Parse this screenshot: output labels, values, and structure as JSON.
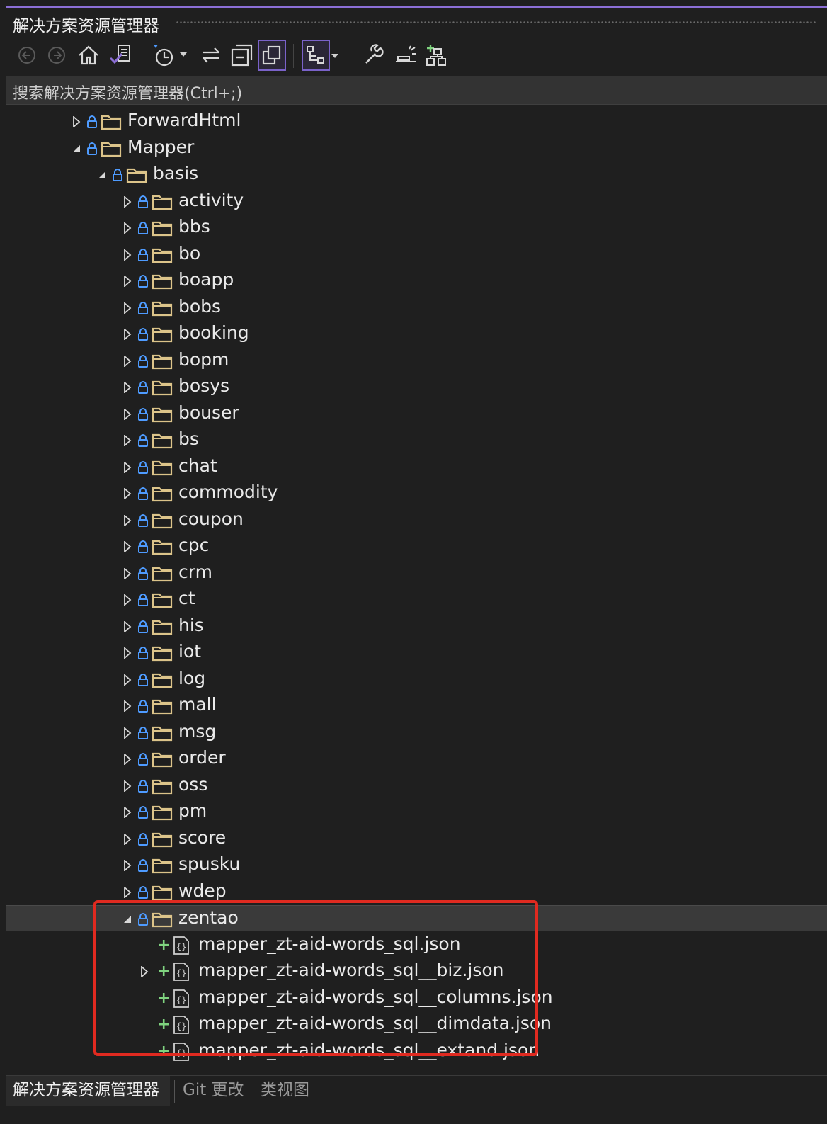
{
  "window": {
    "title": "解决方案资源管理器"
  },
  "search": {
    "placeholder": "搜索解决方案资源管理器(Ctrl+;)"
  },
  "colors": {
    "accent": "#8c6fd6",
    "highlight_box": "#e02a20",
    "folder": "#dcc48a",
    "added": "#7fd37f",
    "lock": "#4e9bff"
  },
  "toolbar": {
    "buttons": [
      {
        "name": "back-button",
        "icon": "arrow-left-circle-icon"
      },
      {
        "name": "forward-button",
        "icon": "arrow-right-circle-icon"
      },
      {
        "name": "home-button",
        "icon": "home-icon"
      },
      {
        "name": "switch-views-button",
        "icon": "visual-studio-views-icon"
      },
      {
        "name": "pending-changes-filter-button",
        "icon": "history-clock-icon"
      },
      {
        "name": "sync-with-document-button",
        "icon": "sync-arrows-icon"
      },
      {
        "name": "collapse-all-button",
        "icon": "collapse-icon"
      },
      {
        "name": "show-all-files-button",
        "icon": "copy-files-icon"
      },
      {
        "name": "view-hierarchy-button",
        "icon": "hierarchy-icon"
      },
      {
        "name": "properties-button",
        "icon": "wrench-icon"
      },
      {
        "name": "preview-selected-button",
        "icon": "preview-icon"
      },
      {
        "name": "new-solution-explorer-button",
        "icon": "new-view-icon"
      }
    ]
  },
  "tree": {
    "nodes": [
      {
        "label": "ForwardHtml",
        "type": "folder",
        "expanded": false,
        "locked": true
      },
      {
        "label": "Mapper",
        "type": "folder",
        "expanded": true,
        "locked": true
      },
      {
        "label": "basis",
        "type": "folder",
        "expanded": true,
        "locked": true
      },
      {
        "label": "activity",
        "type": "folder",
        "expanded": false,
        "locked": true
      },
      {
        "label": "bbs",
        "type": "folder",
        "expanded": false,
        "locked": true
      },
      {
        "label": "bo",
        "type": "folder",
        "expanded": false,
        "locked": true
      },
      {
        "label": "boapp",
        "type": "folder",
        "expanded": false,
        "locked": true
      },
      {
        "label": "bobs",
        "type": "folder",
        "expanded": false,
        "locked": true
      },
      {
        "label": "booking",
        "type": "folder",
        "expanded": false,
        "locked": true
      },
      {
        "label": "bopm",
        "type": "folder",
        "expanded": false,
        "locked": true
      },
      {
        "label": "bosys",
        "type": "folder",
        "expanded": false,
        "locked": true
      },
      {
        "label": "bouser",
        "type": "folder",
        "expanded": false,
        "locked": true
      },
      {
        "label": "bs",
        "type": "folder",
        "expanded": false,
        "locked": true
      },
      {
        "label": "chat",
        "type": "folder",
        "expanded": false,
        "locked": true
      },
      {
        "label": "commodity",
        "type": "folder",
        "expanded": false,
        "locked": true
      },
      {
        "label": "coupon",
        "type": "folder",
        "expanded": false,
        "locked": true
      },
      {
        "label": "cpc",
        "type": "folder",
        "expanded": false,
        "locked": true
      },
      {
        "label": "crm",
        "type": "folder",
        "expanded": false,
        "locked": true
      },
      {
        "label": "ct",
        "type": "folder",
        "expanded": false,
        "locked": true
      },
      {
        "label": "his",
        "type": "folder",
        "expanded": false,
        "locked": true
      },
      {
        "label": "iot",
        "type": "folder",
        "expanded": false,
        "locked": true
      },
      {
        "label": "log",
        "type": "folder",
        "expanded": false,
        "locked": true
      },
      {
        "label": "mall",
        "type": "folder",
        "expanded": false,
        "locked": true
      },
      {
        "label": "msg",
        "type": "folder",
        "expanded": false,
        "locked": true
      },
      {
        "label": "order",
        "type": "folder",
        "expanded": false,
        "locked": true
      },
      {
        "label": "oss",
        "type": "folder",
        "expanded": false,
        "locked": true
      },
      {
        "label": "pm",
        "type": "folder",
        "expanded": false,
        "locked": true
      },
      {
        "label": "score",
        "type": "folder",
        "expanded": false,
        "locked": true
      },
      {
        "label": "spusku",
        "type": "folder",
        "expanded": false,
        "locked": true
      },
      {
        "label": "wdep",
        "type": "folder",
        "expanded": false,
        "locked": true
      },
      {
        "label": "zentao",
        "type": "folder",
        "expanded": true,
        "locked": true,
        "selected": true
      },
      {
        "label": "mapper_zt-aid-words_sql.json",
        "type": "json",
        "added": true
      },
      {
        "label": "mapper_zt-aid-words_sql__biz.json",
        "type": "json",
        "added": true,
        "expandable": true
      },
      {
        "label": "mapper_zt-aid-words_sql__columns.json",
        "type": "json",
        "added": true
      },
      {
        "label": "mapper_zt-aid-words_sql__dimdata.json",
        "type": "json",
        "added": true
      },
      {
        "label": "mapper_zt-aid-words_sql__extand.json",
        "type": "json",
        "added": true
      }
    ]
  },
  "bottom_tabs": {
    "solution_explorer": "解决方案资源管理器",
    "git_changes": "Git 更改",
    "class_view": "类视图"
  }
}
